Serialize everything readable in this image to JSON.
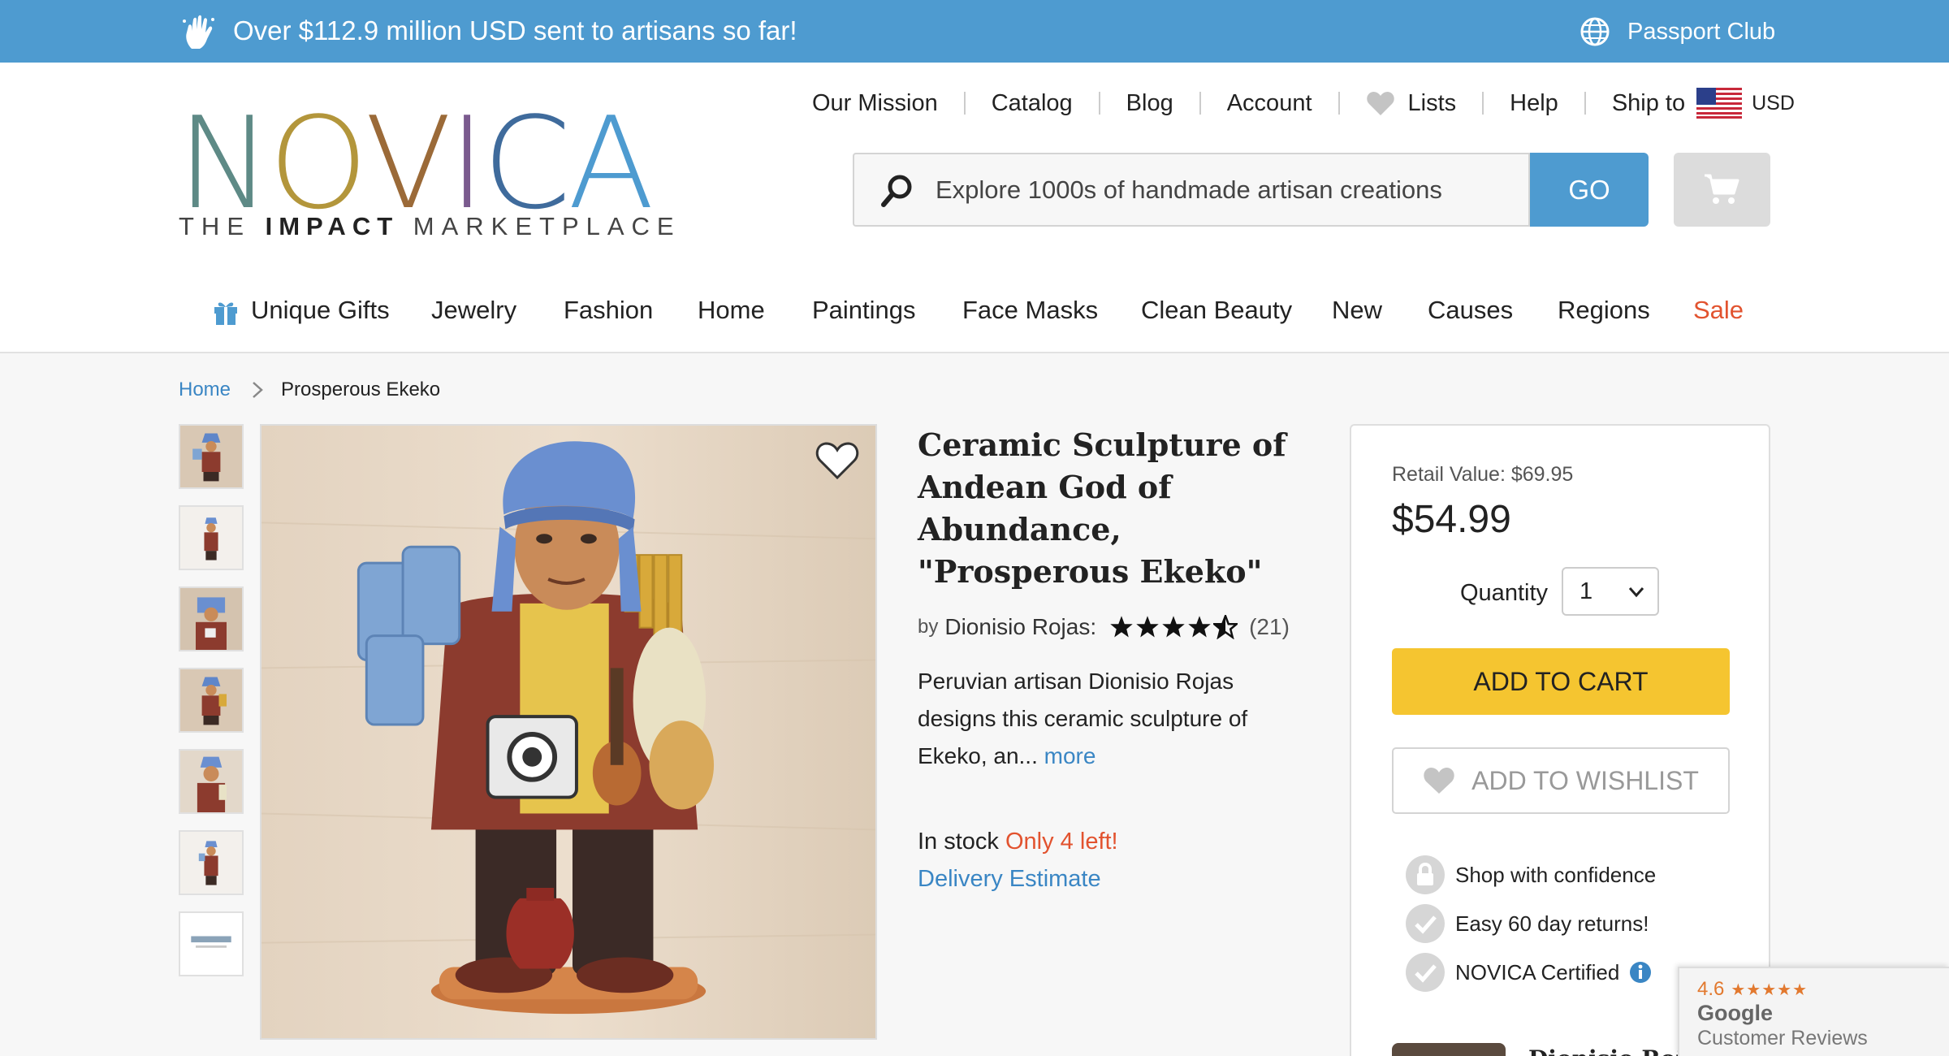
{
  "banner": {
    "message": "Over $112.9 million USD sent to artisans so far!",
    "passport": "Passport Club"
  },
  "logo": {
    "word": [
      "N",
      "O",
      "V",
      "I",
      "C",
      "A"
    ],
    "colors": [
      "#5e8a86",
      "#b3963b",
      "#9b6a38",
      "#7a5a8e",
      "#3f6b9c",
      "#4e9bd0"
    ],
    "tag_prefix": "THE ",
    "tag_bold": "IMPACT",
    "tag_suffix": " MARKETPLACE"
  },
  "topnav": {
    "our_mission": "Our Mission",
    "catalog": "Catalog",
    "blog": "Blog",
    "account": "Account",
    "lists": "Lists",
    "help": "Help",
    "ship_to": "Ship to",
    "currency": "USD"
  },
  "search": {
    "placeholder": "Explore 1000s of handmade artisan creations",
    "go": "GO"
  },
  "categories": {
    "unique_gifts": "Unique Gifts",
    "jewelry": "Jewelry",
    "fashion": "Fashion",
    "home": "Home",
    "paintings": "Paintings",
    "face_masks": "Face Masks",
    "clean_beauty": "Clean Beauty",
    "new": "New",
    "causes": "Causes",
    "regions": "Regions",
    "sale": "Sale"
  },
  "breadcrumb": {
    "home": "Home",
    "current": "Prosperous Ekeko"
  },
  "product": {
    "title": "Ceramic Sculpture of Andean God of Abundance, \"Prosperous Ekeko\"",
    "by": "by",
    "artisan": "Dionisio Rojas:",
    "rating": 4.5,
    "review_count": "(21)",
    "description": "Peruvian artisan Dionisio Rojas designs this ceramic sculpture of Ekeko, an...",
    "more": "more",
    "in_stock": "In stock",
    "only_left": "Only 4 left!",
    "delivery": "Delivery Estimate"
  },
  "buybox": {
    "retail": "Retail Value: $69.95",
    "price": "$54.99",
    "quantity_label": "Quantity",
    "quantity_value": "1",
    "add_to_cart": "ADD TO CART",
    "add_to_wishlist": "ADD TO WISHLIST",
    "assurances": [
      "Shop with confidence",
      "Easy 60 day returns!",
      "NOVICA Certified"
    ],
    "artisan_name": "Dionisio Rojas"
  },
  "google": {
    "score": "4.6",
    "stars": "★★★★★",
    "name": "Google",
    "subtitle": "Customer Reviews"
  },
  "colors": {
    "brand_blue": "#4e9bd0",
    "cart_yellow": "#f5c530",
    "sale_red": "#e2532f",
    "link_blue": "#3a86c4"
  }
}
